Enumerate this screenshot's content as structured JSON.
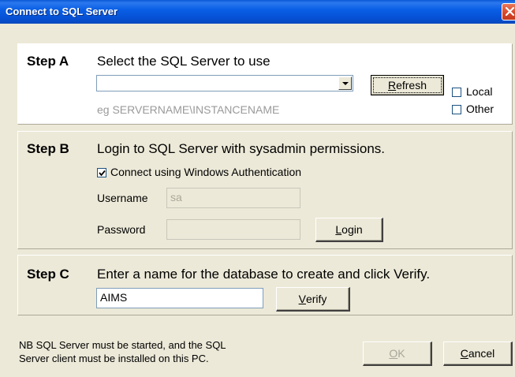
{
  "window": {
    "title": "Connect to SQL Server"
  },
  "step_a": {
    "label": "Step A",
    "instruction": "Select the SQL Server to use",
    "server_combo_value": "",
    "hint": "eg SERVERNAME\\INSTANCENAME",
    "refresh_access_key": "R",
    "refresh_rest": "efresh",
    "local_label": "Local",
    "local_checked": false,
    "other_label": "Other",
    "other_checked": false
  },
  "step_b": {
    "label": "Step B",
    "instruction": "Login to SQL Server with sysadmin permissions.",
    "windows_auth_label": "Connect using Windows Authentication",
    "windows_auth_checked": true,
    "username_label": "Username",
    "username_value": "sa",
    "password_label": "Password",
    "password_value": "",
    "login_access_key": "L",
    "login_rest": "ogin"
  },
  "step_c": {
    "label": "Step C",
    "instruction": "Enter a name for the database to create and click Verify.",
    "database_value": "AIMS",
    "verify_access_key": "V",
    "verify_rest": "erify"
  },
  "footer": {
    "note_line1": "NB SQL Server must be started, and the SQL",
    "note_line2": "Server client must be installed on this PC.",
    "ok_access_key": "O",
    "ok_rest": "K",
    "ok_enabled": false,
    "cancel_access_key": "C",
    "cancel_rest": "ancel"
  }
}
